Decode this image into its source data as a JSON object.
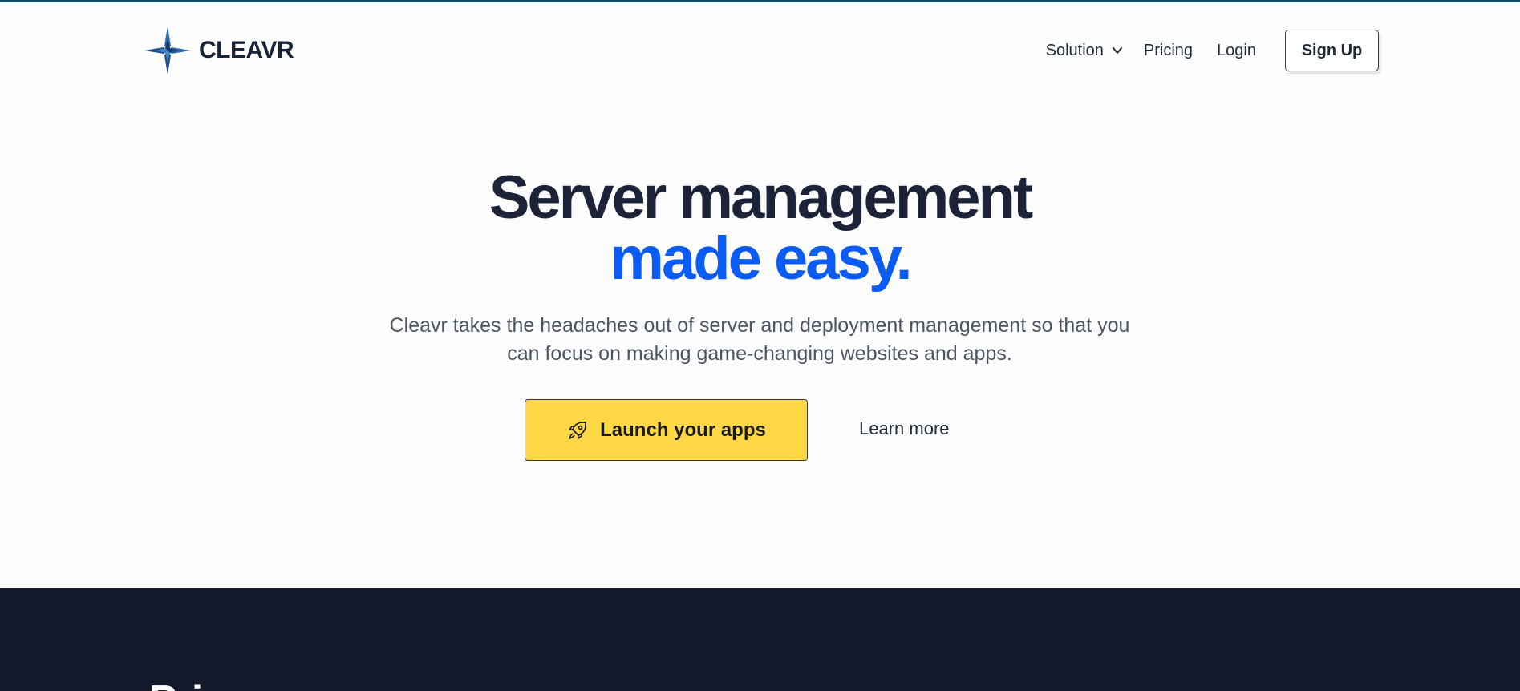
{
  "brand": {
    "name": "CLEAVR",
    "logo_icon": "compass-star-icon",
    "accent_bar_color": "#0f4c5c"
  },
  "nav": {
    "solution_label": "Solution",
    "solution_icon": "chevron-down-icon",
    "pricing_label": "Pricing",
    "login_label": "Login",
    "signup_label": "Sign Up"
  },
  "hero": {
    "title_line1": "Server management",
    "title_line2": "made easy.",
    "title_line2_color": "#0b5cf5",
    "subtitle_line1": "Cleavr takes the headaches out of server and deployment management so that you",
    "subtitle_line2": "can focus on making game-changing websites and apps.",
    "primary_cta": {
      "label": "Launch your apps",
      "icon": "rocket-icon",
      "bg_color": "#fdd844"
    },
    "secondary_cta_label": "Learn more"
  },
  "next_section": {
    "bg_color": "#13182a",
    "heading_partial": "Pri"
  }
}
